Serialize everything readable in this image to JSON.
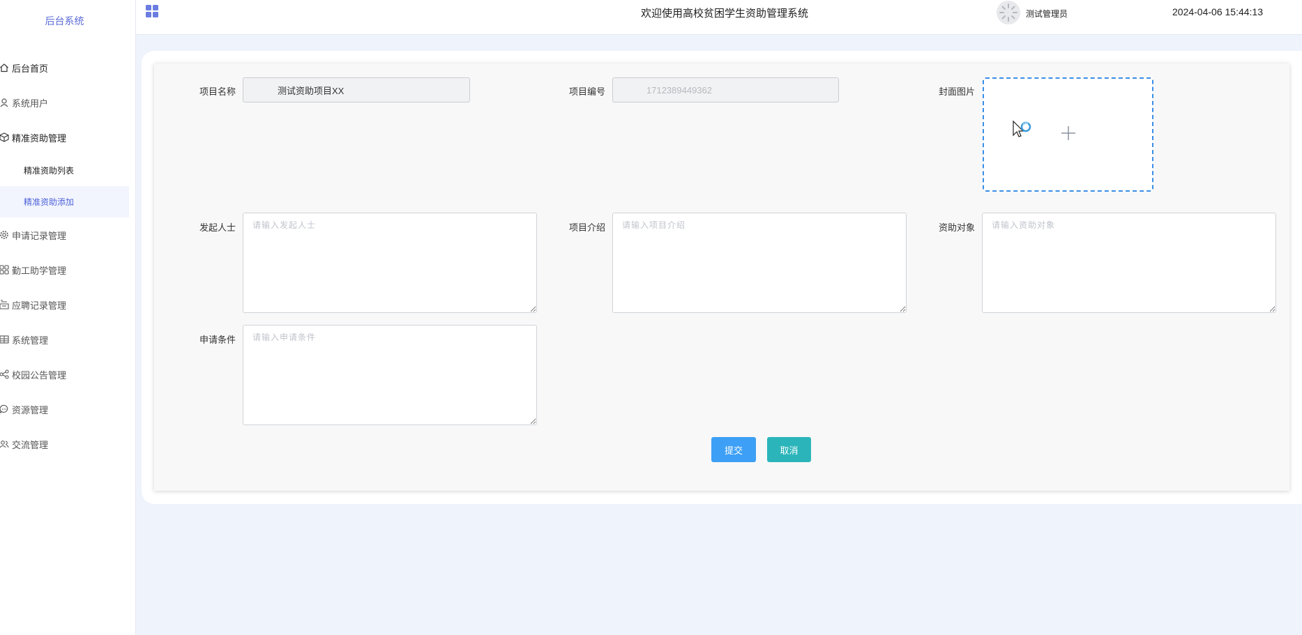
{
  "sidebar": {
    "logo": "后台系统",
    "items": [
      {
        "label": "后台首页",
        "icon": "home-icon"
      },
      {
        "label": "系统用户",
        "icon": "user-icon"
      },
      {
        "label": "精准资助管理",
        "icon": "cube-icon"
      },
      {
        "label": "申请记录管理",
        "icon": "gear-icon"
      },
      {
        "label": "勤工助学管理",
        "icon": "grid-icon"
      },
      {
        "label": "应聘记录管理",
        "icon": "inbox-icon"
      },
      {
        "label": "系统管理",
        "icon": "table-icon"
      },
      {
        "label": "校园公告管理",
        "icon": "share-icon"
      },
      {
        "label": "资源管理",
        "icon": "chat-icon"
      },
      {
        "label": "交流管理",
        "icon": "users-icon"
      }
    ],
    "sub_items": [
      {
        "label": "精准资助列表"
      },
      {
        "label": "精准资助添加"
      }
    ]
  },
  "header": {
    "title": "欢迎使用高校贫困学生资助管理系统",
    "user": "测试管理员",
    "datetime": "2024-04-06 15:44:13"
  },
  "form": {
    "project_name": {
      "label": "项目名称",
      "value": "测试资助项目XX"
    },
    "project_code": {
      "label": "项目编号",
      "value": "1712389449362"
    },
    "cover": {
      "label": "封面图片"
    },
    "initiator": {
      "label": "发起人士",
      "placeholder": "请输入发起人士"
    },
    "intro": {
      "label": "项目介绍",
      "placeholder": "请输入项目介绍"
    },
    "target": {
      "label": "资助对象",
      "placeholder": "请输入资助对象"
    },
    "conditions": {
      "label": "申请条件",
      "placeholder": "请输入申请条件"
    },
    "submit_label": "提交",
    "cancel_label": "取消"
  },
  "colors": {
    "accent": "#4e63d8",
    "submit": "#3d9ff5",
    "cancel": "#2bb5ba",
    "upload_border": "#3a8ee6"
  }
}
